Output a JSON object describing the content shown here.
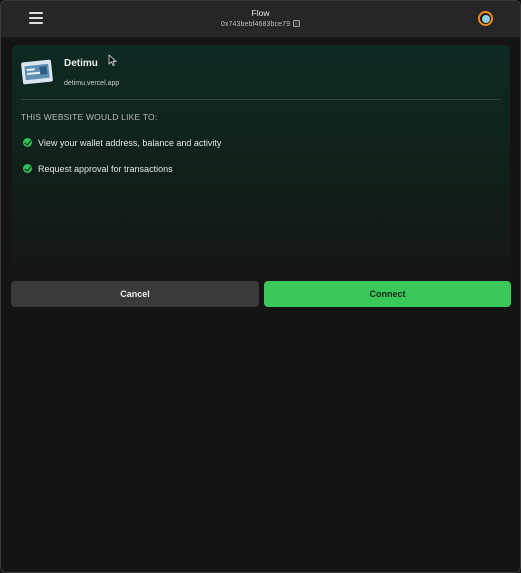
{
  "header": {
    "title": "Flow",
    "address": "0x743bebf4683bce79",
    "menu_icon": "hamburger-menu-icon",
    "copy_icon": "copy-icon",
    "avatar_colors": {
      "ring": "#f28a1a",
      "inner": "#8fd0e6"
    }
  },
  "site": {
    "name": "Detimu",
    "url": "detimu.vercel.app",
    "logo_icon": "site-logo-icon"
  },
  "permissions": {
    "heading": "THIS WEBSITE WOULD LIKE TO:",
    "items": [
      {
        "label": "View your wallet address, balance and activity"
      },
      {
        "label": "Request approval for transactions"
      }
    ],
    "check_color": "#2fbf57"
  },
  "actions": {
    "cancel_label": "Cancel",
    "connect_label": "Connect",
    "connect_color": "#3ac85b"
  }
}
